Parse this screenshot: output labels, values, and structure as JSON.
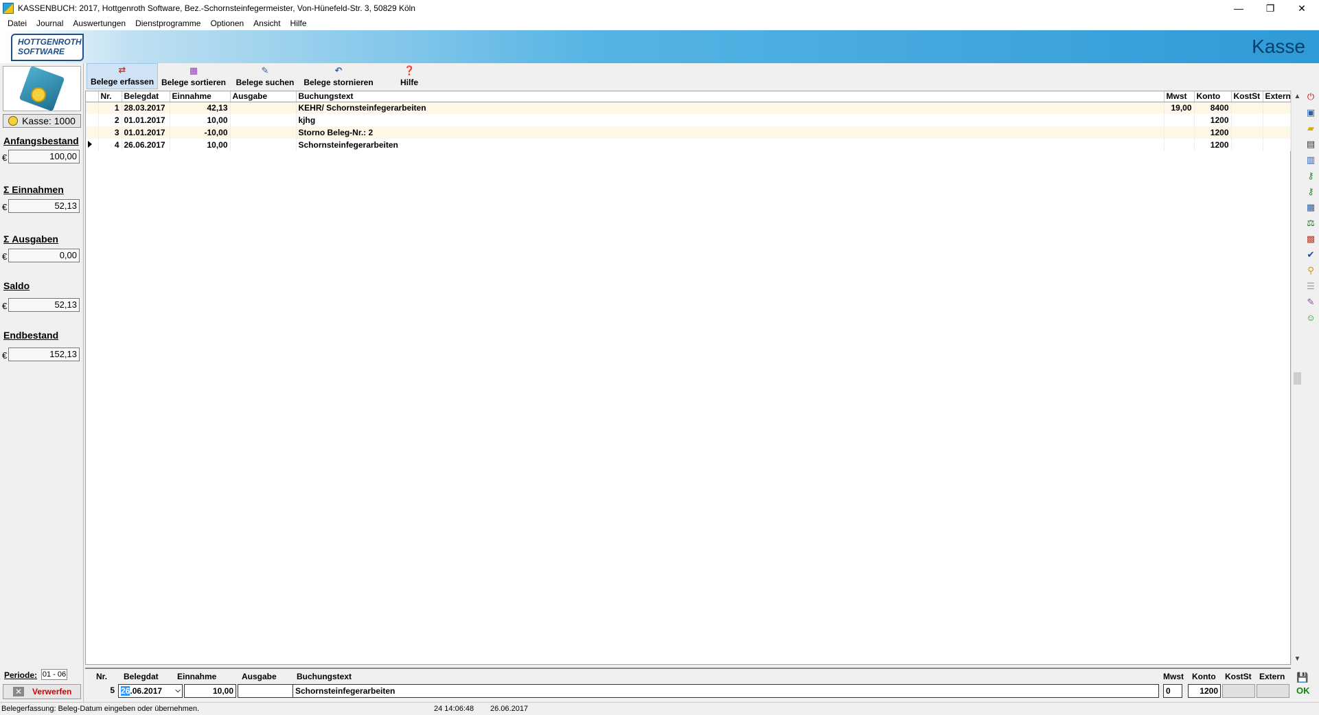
{
  "window": {
    "title": "KASSENBUCH: 2017,  Hottgenroth Software, Bez.-Schornsteinfegermeister, Von-Hünefeld-Str. 3, 50829 Köln",
    "minimize": "—",
    "restore": "❐",
    "close": "✕"
  },
  "menu": [
    "Datei",
    "Journal",
    "Auswertungen",
    "Dienstprogramme",
    "Optionen",
    "Ansicht",
    "Hilfe"
  ],
  "banner": {
    "logo_line1": "HOTTGENROTH",
    "logo_line2": "SOFTWARE",
    "title": "Kasse"
  },
  "left": {
    "kasse_label": "Kasse: 1000",
    "anfangsbestand_label": "Anfangsbestand",
    "anfangsbestand_value": "100,00",
    "einnahmen_label": "Σ Einnahmen",
    "einnahmen_value": "52,13",
    "ausgaben_label": "Σ Ausgaben",
    "ausgaben_value": "0,00",
    "saldo_label": "Saldo",
    "saldo_value": "52,13",
    "endbestand_label": "Endbestand",
    "endbestand_value": "152,13",
    "currency": "€",
    "periode_label": "Periode:",
    "periode_value": "01 - 06",
    "verwerfen_label": "Verwerfen"
  },
  "toolbar": [
    {
      "label": "Belege erfassen",
      "icon": "edit-list-icon",
      "active": true
    },
    {
      "label": "Belege sortieren",
      "icon": "sort-icon",
      "active": false
    },
    {
      "label": "Belege suchen",
      "icon": "search-icon",
      "active": false
    },
    {
      "label": "Belege stornieren",
      "icon": "undo-icon",
      "active": false
    },
    {
      "label": "Hilfe",
      "icon": "help-icon",
      "active": false
    }
  ],
  "grid": {
    "columns": [
      "Nr.",
      "Belegdat",
      "Einnahme",
      "Ausgabe",
      "Buchungstext",
      "Mwst",
      "Konto",
      "KostSt",
      "Extern"
    ],
    "rows": [
      {
        "nr": "1",
        "belegdat": "28.03.2017",
        "einnahme": "42,13",
        "ausgabe": "",
        "text": "KEHR/ Schornsteinfegerarbeiten",
        "mwst": "19,00",
        "konto": "8400",
        "kostst": "",
        "extern": ""
      },
      {
        "nr": "2",
        "belegdat": "01.01.2017",
        "einnahme": "10,00",
        "ausgabe": "",
        "text": "kjhg",
        "mwst": "",
        "konto": "1200",
        "kostst": "",
        "extern": ""
      },
      {
        "nr": "3",
        "belegdat": "01.01.2017",
        "einnahme": "-10,00",
        "ausgabe": "",
        "text": "Storno Beleg-Nr.: 2",
        "mwst": "",
        "konto": "1200",
        "kostst": "",
        "extern": ""
      },
      {
        "nr": "4",
        "belegdat": "26.06.2017",
        "einnahme": "10,00",
        "ausgabe": "",
        "text": "Schornsteinfegerarbeiten",
        "mwst": "",
        "konto": "1200",
        "kostst": "",
        "extern": ""
      }
    ]
  },
  "entry": {
    "headers": {
      "nr": "Nr.",
      "belegdat": "Belegdat",
      "einnahme": "Einnahme",
      "ausgabe": "Ausgabe",
      "text": "Buchungstext",
      "mwst": "Mwst",
      "konto": "Konto",
      "kostst": "KostSt",
      "extern": "Extern"
    },
    "nr": "5",
    "belegdat_day": "26",
    "belegdat_rest": ".06.2017",
    "einnahme": "10,00",
    "ausgabe": "",
    "text": "Schornsteinfegerarbeiten",
    "mwst": "0",
    "konto": "1200",
    "ok_label": "OK"
  },
  "status": {
    "message": "Belegerfassung: Beleg-Datum eingeben oder übernehmen.",
    "time": "24  14:06:48",
    "date": "26.06.2017"
  }
}
